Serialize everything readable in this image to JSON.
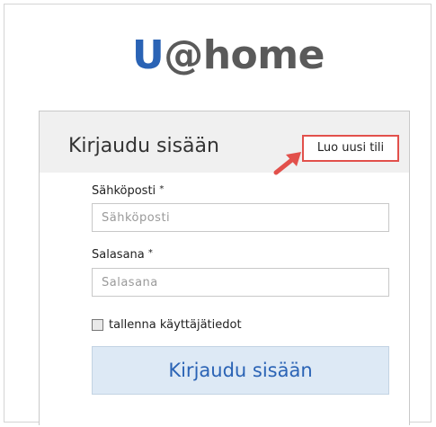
{
  "logo": {
    "u": "U",
    "rest": "@home"
  },
  "login": {
    "title": "Kirjaudu sisään",
    "create_account": "Luo uusi tili",
    "email_label": "Sähköposti",
    "email_placeholder": "Sähköposti",
    "password_label": "Salasana",
    "password_placeholder": "Salasana",
    "required_mark": "*",
    "remember_label": "tallenna käyttäjätiedot",
    "submit_label": "Kirjaudu sisään"
  },
  "colors": {
    "brand_blue": "#2a63b5",
    "logo_gray": "#5a5a5a",
    "highlight_red": "#e2504b",
    "button_bg": "#dde9f5"
  },
  "icons": {
    "annotation": "arrow-up-right-icon"
  }
}
